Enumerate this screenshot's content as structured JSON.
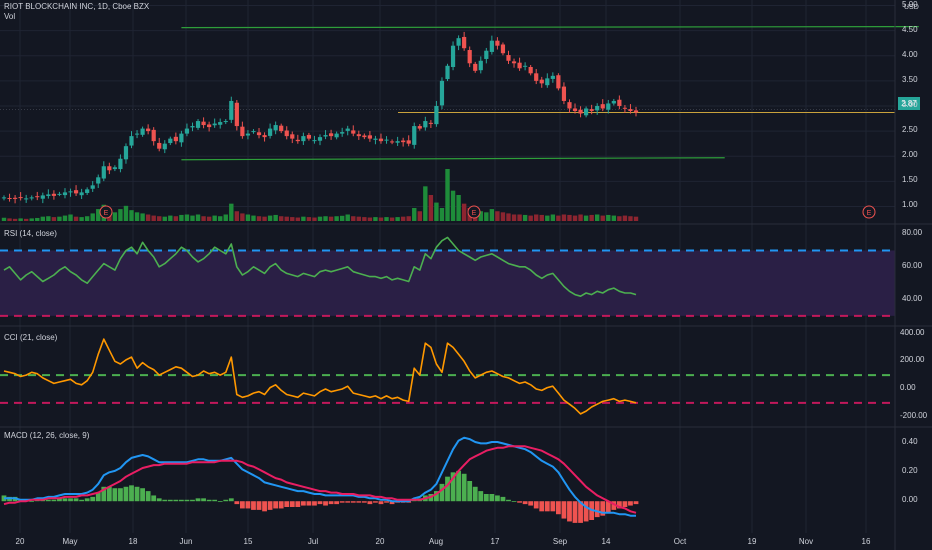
{
  "chart_data": [
    {
      "type": "candlestick",
      "title": "RIOT BLOCKCHAIN INC, 1D, Cboe BZX",
      "volume_label": "Vol",
      "currency_label": "USD",
      "last_price_label": "2.87",
      "y_ticks": [
        "5.00",
        "4.50",
        "4.00",
        "3.50",
        "3.00",
        "2.50",
        "2.00",
        "1.50",
        "1.00"
      ],
      "ylim": [
        0.75,
        5.05
      ],
      "x_ticks": [
        "20",
        "May",
        "18",
        "Jun",
        "15",
        "Jul",
        "20",
        "Aug",
        "17",
        "Sep",
        "14",
        "Oct",
        "19",
        "Nov",
        "16"
      ],
      "earnings_marker": "E",
      "grid": true,
      "colors": {
        "up": "#26a69a",
        "down": "#ef5350",
        "vol_up": "#1e8c3a",
        "vol_down": "#8c2530",
        "trendline": "#2e9e3a",
        "last_line": "#c9a23c",
        "bg": "#131722",
        "grid": "#1f2433"
      },
      "closes": [
        1.18,
        1.16,
        1.15,
        1.17,
        1.16,
        1.18,
        1.19,
        1.22,
        1.24,
        1.21,
        1.25,
        1.28,
        1.3,
        1.26,
        1.28,
        1.34,
        1.42,
        1.58,
        1.8,
        1.72,
        1.78,
        1.95,
        2.2,
        2.4,
        2.45,
        2.55,
        2.5,
        2.3,
        2.15,
        2.25,
        2.35,
        2.3,
        2.45,
        2.55,
        2.6,
        2.7,
        2.62,
        2.58,
        2.65,
        2.68,
        2.7,
        3.1,
        2.6,
        2.4,
        2.45,
        2.5,
        2.42,
        2.38,
        2.55,
        2.62,
        2.5,
        2.4,
        2.35,
        2.3,
        2.4,
        2.35,
        2.32,
        2.38,
        2.42,
        2.4,
        2.45,
        2.48,
        2.55,
        2.45,
        2.4,
        2.38,
        2.35,
        2.35,
        2.3,
        2.33,
        2.28,
        2.3,
        2.28,
        2.25,
        2.6,
        2.55,
        2.7,
        2.65,
        3.0,
        3.5,
        3.8,
        4.2,
        4.35,
        4.15,
        3.85,
        3.7,
        3.9,
        4.1,
        4.3,
        4.2,
        4.05,
        3.9,
        3.85,
        3.75,
        3.8,
        3.65,
        3.5,
        3.45,
        3.55,
        3.6,
        3.35,
        3.1,
        2.95,
        2.9,
        2.85,
        2.95,
        2.9,
        3.0,
        2.95,
        3.05,
        3.1,
        3.0,
        2.95,
        2.9,
        2.87
      ],
      "volumes": [
        0.15,
        0.12,
        0.1,
        0.12,
        0.1,
        0.12,
        0.14,
        0.2,
        0.22,
        0.18,
        0.2,
        0.25,
        0.3,
        0.2,
        0.18,
        0.22,
        0.35,
        0.55,
        0.75,
        0.45,
        0.4,
        0.55,
        0.7,
        0.5,
        0.4,
        0.35,
        0.3,
        0.25,
        0.22,
        0.2,
        0.25,
        0.22,
        0.28,
        0.3,
        0.25,
        0.3,
        0.22,
        0.2,
        0.25,
        0.22,
        0.3,
        0.8,
        0.45,
        0.35,
        0.3,
        0.25,
        0.22,
        0.2,
        0.25,
        0.28,
        0.22,
        0.2,
        0.18,
        0.16,
        0.2,
        0.18,
        0.16,
        0.2,
        0.22,
        0.2,
        0.22,
        0.24,
        0.3,
        0.22,
        0.2,
        0.18,
        0.16,
        0.18,
        0.16,
        0.18,
        0.16,
        0.18,
        0.2,
        0.22,
        0.6,
        0.45,
        1.6,
        1.2,
        0.85,
        0.6,
        2.4,
        1.4,
        1.2,
        0.8,
        0.6,
        0.5,
        0.45,
        0.4,
        0.55,
        0.45,
        0.4,
        0.35,
        0.3,
        0.3,
        0.28,
        0.25,
        0.3,
        0.28,
        0.25,
        0.3,
        0.25,
        0.3,
        0.28,
        0.25,
        0.3,
        0.25,
        0.28,
        0.3,
        0.25,
        0.28,
        0.25,
        0.22,
        0.25,
        0.22,
        0.2
      ],
      "trendlines": [
        {
          "from": [
            1.93,
            72
          ],
          "to": [
            1.97,
            170
          ]
        },
        {
          "from": [
            4.56,
            72
          ],
          "to": [
            4.58,
            205
          ]
        }
      ]
    },
    {
      "type": "line",
      "title": "RSI (14, close)",
      "y_ticks": [
        "80.00",
        "60.00",
        "40.00"
      ],
      "ylim": [
        25,
        85
      ],
      "band": [
        30,
        70
      ],
      "colors": {
        "line": "#4caf50",
        "band": "#2a1f45",
        "upper": "#2196f3",
        "lower": "#c2185b"
      },
      "values": [
        58,
        60,
        56,
        52,
        55,
        57,
        54,
        51,
        53,
        55,
        58,
        60,
        57,
        55,
        52,
        50,
        54,
        58,
        62,
        60,
        58,
        65,
        70,
        72,
        68,
        75,
        70,
        66,
        60,
        62,
        65,
        68,
        72,
        70,
        66,
        63,
        65,
        68,
        72,
        70,
        68,
        74,
        60,
        55,
        57,
        60,
        58,
        56,
        60,
        62,
        58,
        56,
        55,
        54,
        56,
        55,
        54,
        57,
        58,
        57,
        58,
        59,
        60,
        57,
        56,
        55,
        54,
        54,
        53,
        54,
        52,
        53,
        52,
        51,
        60,
        58,
        68,
        65,
        72,
        76,
        78,
        74,
        70,
        68,
        66,
        64,
        66,
        67,
        68,
        66,
        64,
        62,
        61,
        60,
        60,
        58,
        55,
        53,
        55,
        56,
        52,
        48,
        45,
        43,
        42,
        44,
        43,
        45,
        44,
        46,
        47,
        45,
        44,
        44,
        43
      ]
    },
    {
      "type": "line",
      "title": "CCI (21, close)",
      "y_ticks": [
        "400.00",
        "200.00",
        "0.00",
        "-200.00"
      ],
      "ylim": [
        -260,
        440
      ],
      "levels": [
        100,
        -100
      ],
      "colors": {
        "line": "#ff9800",
        "upper": "#4caf50",
        "lower": "#c2185b"
      },
      "values": [
        130,
        120,
        110,
        90,
        100,
        120,
        110,
        80,
        60,
        40,
        50,
        60,
        70,
        40,
        30,
        60,
        120,
        250,
        360,
        280,
        200,
        180,
        210,
        230,
        150,
        190,
        160,
        140,
        100,
        120,
        140,
        160,
        150,
        120,
        90,
        100,
        130,
        110,
        120,
        100,
        120,
        230,
        -40,
        -60,
        -50,
        -30,
        -20,
        -40,
        10,
        30,
        -10,
        -40,
        -50,
        -60,
        -30,
        -40,
        -50,
        -20,
        0,
        -20,
        -10,
        0,
        20,
        -30,
        -40,
        -50,
        -60,
        -50,
        -70,
        -50,
        -70,
        -60,
        -80,
        -90,
        150,
        100,
        330,
        300,
        180,
        120,
        330,
        300,
        250,
        200,
        130,
        80,
        100,
        120,
        130,
        110,
        90,
        80,
        60,
        40,
        50,
        30,
        0,
        -10,
        10,
        20,
        -30,
        -80,
        -110,
        -140,
        -180,
        -160,
        -130,
        -110,
        -90,
        -80,
        -70,
        -90,
        -80,
        -90,
        -100
      ]
    },
    {
      "type": "line",
      "title": "MACD (12, 26, close, 9)",
      "y_ticks": [
        "0.40",
        "0.20",
        "0.00"
      ],
      "ylim": [
        -0.22,
        0.5
      ],
      "colors": {
        "macd": "#2196f3",
        "signal": "#e91e63",
        "hist_up": "#4caf50",
        "hist_down": "#ef5350"
      },
      "macd": [
        0.02,
        0.02,
        0.02,
        0.01,
        0.01,
        0.01,
        0.02,
        0.02,
        0.03,
        0.03,
        0.04,
        0.05,
        0.05,
        0.05,
        0.05,
        0.06,
        0.08,
        0.12,
        0.18,
        0.2,
        0.21,
        0.23,
        0.27,
        0.3,
        0.31,
        0.32,
        0.31,
        0.29,
        0.27,
        0.27,
        0.27,
        0.27,
        0.27,
        0.27,
        0.28,
        0.29,
        0.29,
        0.28,
        0.28,
        0.28,
        0.29,
        0.3,
        0.26,
        0.22,
        0.2,
        0.18,
        0.16,
        0.13,
        0.12,
        0.11,
        0.1,
        0.09,
        0.08,
        0.07,
        0.07,
        0.06,
        0.05,
        0.05,
        0.04,
        0.04,
        0.04,
        0.04,
        0.04,
        0.04,
        0.03,
        0.03,
        0.02,
        0.02,
        0.01,
        0.01,
        0.0,
        0.0,
        0.0,
        0.0,
        0.02,
        0.03,
        0.06,
        0.08,
        0.12,
        0.2,
        0.28,
        0.36,
        0.42,
        0.44,
        0.43,
        0.41,
        0.4,
        0.4,
        0.41,
        0.41,
        0.4,
        0.39,
        0.38,
        0.37,
        0.36,
        0.34,
        0.31,
        0.28,
        0.26,
        0.24,
        0.2,
        0.14,
        0.08,
        0.03,
        -0.01,
        -0.04,
        -0.06,
        -0.07,
        -0.08,
        -0.08,
        -0.08,
        -0.09,
        -0.09,
        -0.1,
        -0.1
      ],
      "signal": [
        -0.02,
        -0.01,
        -0.01,
        0.0,
        0.0,
        0.01,
        0.01,
        0.01,
        0.02,
        0.02,
        0.02,
        0.03,
        0.03,
        0.03,
        0.04,
        0.04,
        0.05,
        0.06,
        0.08,
        0.1,
        0.12,
        0.14,
        0.17,
        0.19,
        0.21,
        0.23,
        0.24,
        0.25,
        0.25,
        0.26,
        0.26,
        0.26,
        0.26,
        0.26,
        0.27,
        0.27,
        0.27,
        0.27,
        0.27,
        0.28,
        0.28,
        0.28,
        0.28,
        0.27,
        0.25,
        0.24,
        0.22,
        0.2,
        0.18,
        0.16,
        0.15,
        0.13,
        0.12,
        0.11,
        0.1,
        0.09,
        0.08,
        0.07,
        0.07,
        0.06,
        0.06,
        0.05,
        0.05,
        0.05,
        0.04,
        0.04,
        0.04,
        0.03,
        0.03,
        0.02,
        0.02,
        0.01,
        0.01,
        0.01,
        0.01,
        0.01,
        0.02,
        0.03,
        0.05,
        0.08,
        0.11,
        0.16,
        0.21,
        0.25,
        0.29,
        0.31,
        0.33,
        0.35,
        0.36,
        0.37,
        0.37,
        0.38,
        0.38,
        0.38,
        0.38,
        0.37,
        0.36,
        0.35,
        0.33,
        0.31,
        0.29,
        0.26,
        0.22,
        0.18,
        0.14,
        0.1,
        0.07,
        0.04,
        0.02,
        0.0,
        -0.02,
        -0.04,
        -0.05,
        -0.07,
        -0.08
      ]
    }
  ]
}
